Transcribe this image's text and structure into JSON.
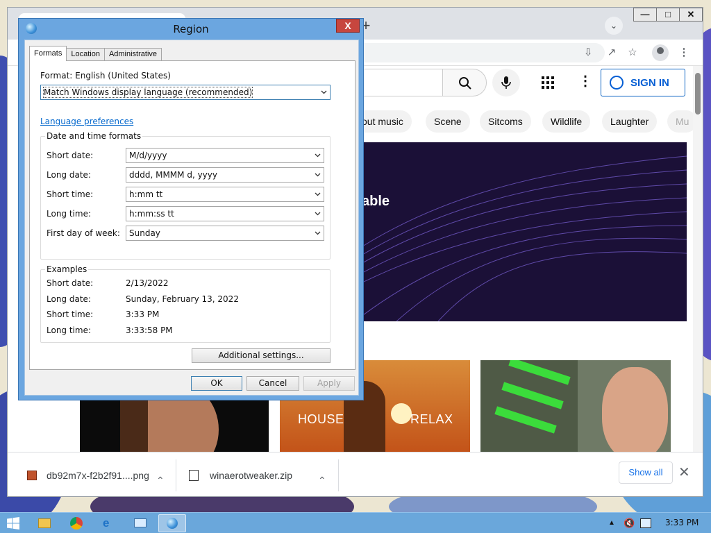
{
  "dialog": {
    "title": "Region",
    "tabs": [
      "Formats",
      "Location",
      "Administrative"
    ],
    "format_label": "Format: English (United States)",
    "format_value": "Match Windows display language (recommended)",
    "language_link": "Language preferences",
    "datetime_group": "Date and time formats",
    "fields": [
      {
        "label": "Short date:",
        "value": "M/d/yyyy"
      },
      {
        "label": "Long date:",
        "value": "dddd, MMMM d, yyyy"
      },
      {
        "label": "Short time:",
        "value": "h:mm tt"
      },
      {
        "label": "Long time:",
        "value": "h:mm:ss tt"
      },
      {
        "label": "First day of week:",
        "value": "Sunday"
      }
    ],
    "examples_group": "Examples",
    "examples": [
      {
        "label": "Short date:",
        "value": "2/13/2022"
      },
      {
        "label": "Long date:",
        "value": "Sunday, February 13, 2022"
      },
      {
        "label": "Short time:",
        "value": "3:33 PM"
      },
      {
        "label": "Long time:",
        "value": "3:33:58 PM"
      }
    ],
    "additional_settings": "Additional settings...",
    "ok": "OK",
    "cancel": "Cancel",
    "apply": "Apply",
    "close": "X"
  },
  "browser": {
    "sign_in": "SIGN IN",
    "chips": [
      "out music",
      "Scene",
      "Sitcoms",
      "Wildlife",
      "Laughter",
      "Mu"
    ],
    "banner_text": "able",
    "thumbs": [
      {
        "left_label": "HOUSE",
        "right_label": "RELAX"
      }
    ],
    "downloads": [
      {
        "name": "db92m7x-f2b2f91....png"
      },
      {
        "name": "winaerotweaker.zip"
      }
    ],
    "show_all": "Show all"
  },
  "taskbar": {
    "time": "3:33 PM"
  },
  "colors": {
    "dialog_frame": "#6ba6e0",
    "taskbar": "#6aa7db",
    "link": "#0066cc",
    "yt_blue": "#065fd4"
  }
}
